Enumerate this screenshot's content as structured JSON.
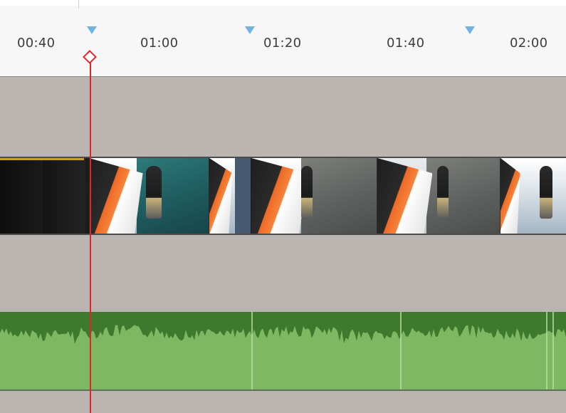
{
  "ruler": {
    "time_labels": [
      "00:40",
      "01:00",
      "01:20",
      "01:40",
      "02:00"
    ],
    "marker_color": "#6fb3e0"
  },
  "colors": {
    "playhead": "#e0242a",
    "audio_dark": "#3d7a2e",
    "audio_light": "#7fb862",
    "track_background": "#bbb5b2"
  },
  "icons": {
    "marker": "triangle-down",
    "playhead_handle": "diamond"
  }
}
